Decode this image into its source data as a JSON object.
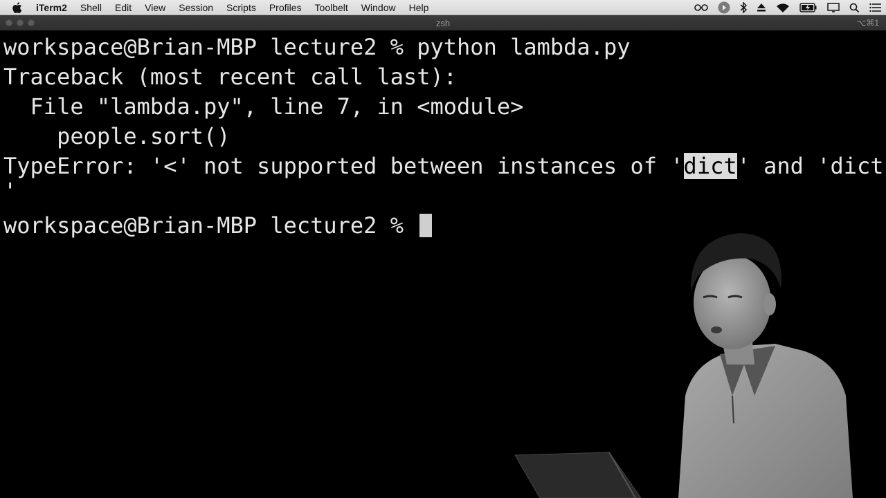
{
  "menubar": {
    "app_name": "iTerm2",
    "menus": [
      "Shell",
      "Edit",
      "View",
      "Session",
      "Scripts",
      "Profiles",
      "Toolbelt",
      "Window",
      "Help"
    ]
  },
  "window": {
    "title": "zsh",
    "shortcut": "⌥⌘1"
  },
  "terminal": {
    "lines": {
      "l1": "workspace@Brian-MBP lecture2 % python lambda.py",
      "l2": "Traceback (most recent call last):",
      "l3": "  File \"lambda.py\", line 7, in <module>",
      "l4": "    people.sort()",
      "l5_a": "TypeError: '<' not supported between instances of '",
      "l5_sel": "dict",
      "l5_b": "' and 'dict",
      "l6": "'",
      "l7": "workspace@Brian-MBP lecture2 % "
    }
  },
  "colors": {
    "background": "#000000",
    "text": "#e6e6e6",
    "selection": "#dcdcdc"
  }
}
